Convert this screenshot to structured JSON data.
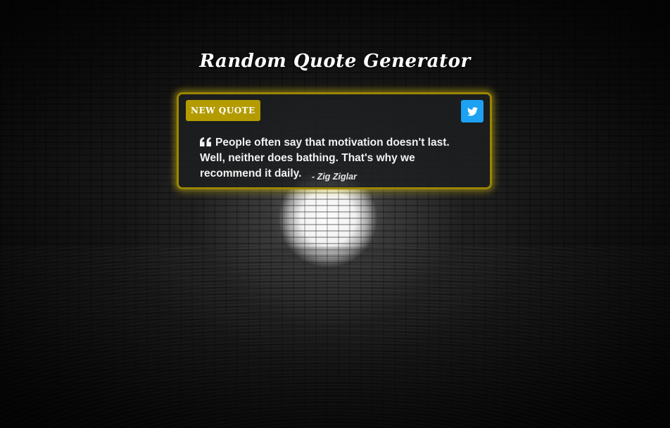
{
  "page": {
    "title": "Random Quote Generator"
  },
  "quote_box": {
    "new_quote_label": "New Quote",
    "tweet_icon": "twitter-icon",
    "quote_icon": "quote-left-icon",
    "quote_text": "People often say that motivation doesn't last. Well, neither does bathing. That's why we recommend it daily.",
    "author": "- Zig Ziglar"
  },
  "colors": {
    "accent_gold": "#b39b00",
    "card_border": "#9a8600",
    "twitter_blue": "#1da1f2",
    "card_background": "rgba(28,30,32,0.86)"
  }
}
